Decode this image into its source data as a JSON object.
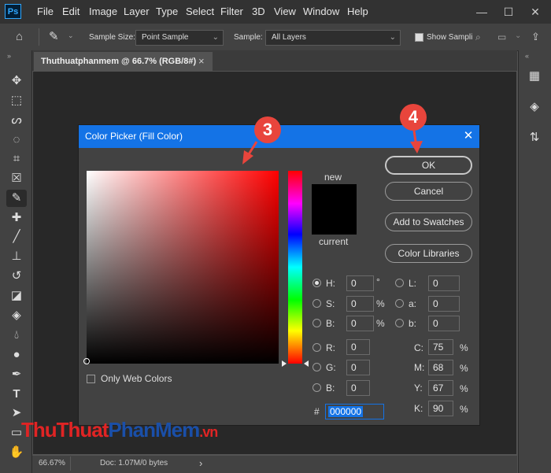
{
  "app": {
    "logo": "Ps",
    "menu": [
      "File",
      "Edit",
      "Image",
      "Layer",
      "Type",
      "Select",
      "Filter",
      "3D",
      "View",
      "Window",
      "Help"
    ],
    "window_controls": [
      "—",
      "☐",
      "✕"
    ]
  },
  "options_bar": {
    "sample_size_label": "Sample Size:",
    "sample_size_value": "Point Sample",
    "sample_label": "Sample:",
    "sample_value": "All Layers",
    "show_sampling_label": "Show Sampli"
  },
  "document": {
    "tab_title": "Thuthuatphanmem @ 66.7% (RGB/8#)",
    "tab_close": "×",
    "zoom": "66.67%",
    "doc_info": "Doc: 1.07M/0 bytes",
    "status_arrow": "›"
  },
  "dialog": {
    "title": "Color Picker (Fill Color)",
    "close": "✕",
    "new_label": "new",
    "current_label": "current",
    "new_color": "#000000",
    "current_color": "#000000",
    "buttons": {
      "ok": "OK",
      "cancel": "Cancel",
      "add_to_swatches": "Add to Swatches",
      "color_libraries": "Color Libraries"
    },
    "hsb": {
      "h": {
        "label": "H:",
        "value": "0",
        "unit": "°"
      },
      "s": {
        "label": "S:",
        "value": "0",
        "unit": "%"
      },
      "b": {
        "label": "B:",
        "value": "0",
        "unit": "%"
      }
    },
    "lab": {
      "l": {
        "label": "L:",
        "value": "0"
      },
      "a": {
        "label": "a:",
        "value": "0"
      },
      "b": {
        "label": "b:",
        "value": "0"
      }
    },
    "rgb": {
      "r": {
        "label": "R:",
        "value": "0"
      },
      "g": {
        "label": "G:",
        "value": "0"
      },
      "b": {
        "label": "B:",
        "value": "0"
      }
    },
    "cmyk": {
      "c": {
        "label": "C:",
        "value": "75",
        "unit": "%"
      },
      "m": {
        "label": "M:",
        "value": "68",
        "unit": "%"
      },
      "y": {
        "label": "Y:",
        "value": "67",
        "unit": "%"
      },
      "k": {
        "label": "K:",
        "value": "90",
        "unit": "%"
      }
    },
    "hex_label": "#",
    "hex_value": "000000",
    "only_web_colors": "Only Web Colors"
  },
  "annotations": {
    "marker_3": "3",
    "marker_4": "4"
  },
  "watermark": {
    "part1": "ThuThuat",
    "part2": "PhanMem",
    "part3": ".vn"
  },
  "colors": {
    "accent_blue": "#1473e6",
    "marker_red": "#e8453c"
  }
}
